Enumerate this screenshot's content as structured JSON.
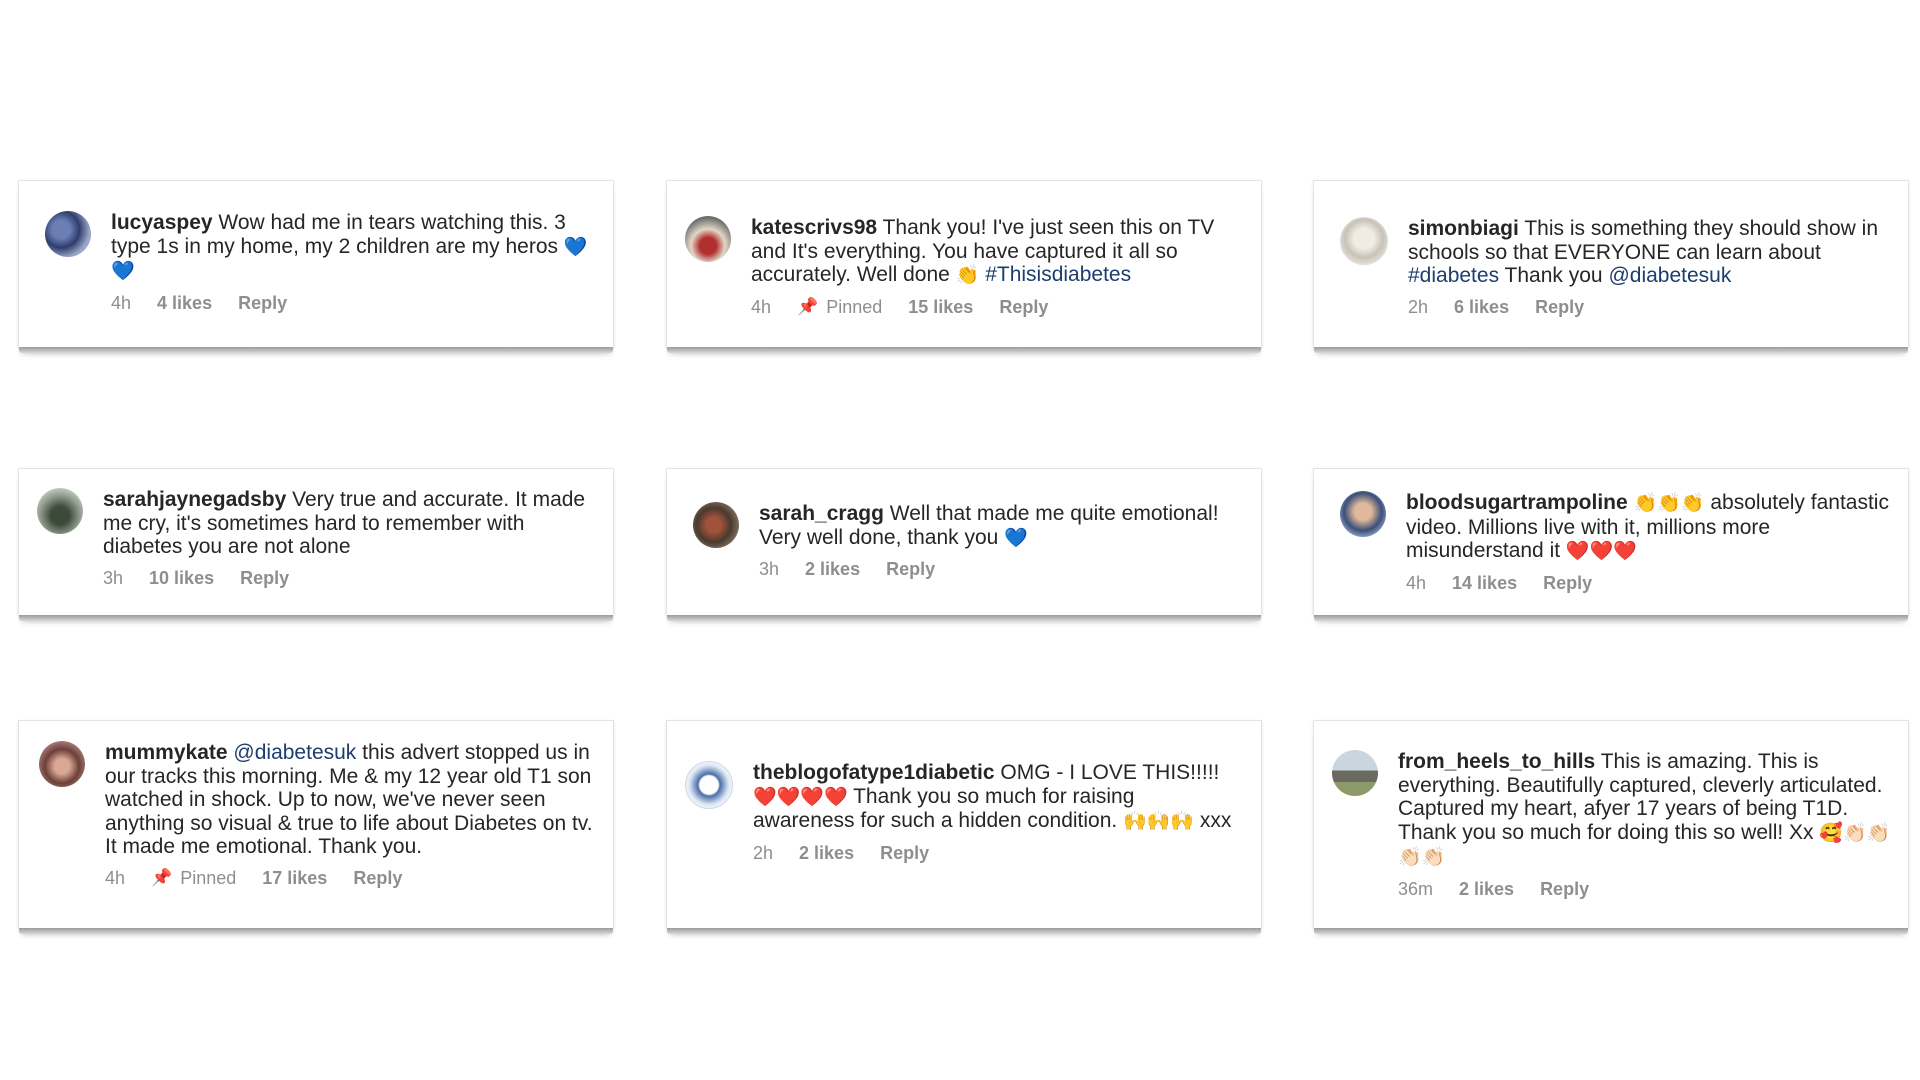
{
  "comments": [
    {
      "user": "lucyaspey",
      "text": "Wow had me in tears watching this. 3 type 1s in my home, my 2 children are my heros",
      "emoji": "💙💙",
      "time": "4h",
      "likes": "4 likes",
      "reply": "Reply"
    },
    {
      "user": "katescrivs98",
      "text": "Thank you! I've just seen this on TV and It's everything. You have captured it all so accurately. Well done",
      "emoji": "👏",
      "tag": "#Thisisdiabetes",
      "time": "4h",
      "pinned": "Pinned",
      "likes": "15 likes",
      "reply": "Reply"
    },
    {
      "user": "simonbiagi",
      "text": "This is something they should show in schools so that EVERYONE can learn about",
      "tag": "#diabetes",
      "text2": "Thank you",
      "mention": "@diabetesuk",
      "time": "2h",
      "likes": "6 likes",
      "reply": "Reply"
    },
    {
      "user": "sarahjaynegadsby",
      "text": "Very true and accurate. It made me cry, it's sometimes hard to remember with diabetes you are not alone",
      "time": "3h",
      "likes": "10 likes",
      "reply": "Reply"
    },
    {
      "user": "sarah_cragg",
      "text": "Well that made me quite emotional! Very well done, thank you",
      "emoji": "💙",
      "time": "3h",
      "likes": "2 likes",
      "reply": "Reply"
    },
    {
      "user": "bloodsugartrampoline",
      "emoji": "👏👏👏",
      "text": "absolutely fantastic video. Millions live with it, millions more misunderstand it",
      "emoji2": "❤️❤️❤️",
      "time": "4h",
      "likes": "14 likes",
      "reply": "Reply"
    },
    {
      "user": "mummykate",
      "mention": "@diabetesuk",
      "text": "this advert stopped us in our tracks this morning. Me & my 12 year old T1 son watched in shock. Up to now, we've never seen anything so visual & true to life about Diabetes on tv. It made me emotional. Thank you.",
      "time": "4h",
      "pinned": "Pinned",
      "likes": "17 likes",
      "reply": "Reply"
    },
    {
      "user": "theblogofatype1diabetic",
      "text": "OMG - I LOVE THIS!!!!!",
      "emoji": "❤️❤️❤️❤️",
      "text2": "Thank you so much for raising awareness for such a hidden condition.",
      "emoji2": "🙌🙌🙌",
      "text3": "xxx",
      "time": "2h",
      "likes": "2 likes",
      "reply": "Reply"
    },
    {
      "user": "from_heels_to_hills",
      "text": "This is amazing. This is everything. Beautifully captured, cleverly articulated. Captured my heart, afyer 17 years of being T1D. Thank you so much for doing this so well! Xx",
      "emoji": "🥰👏🏻👏🏻👏🏻👏🏻",
      "time": "36m",
      "likes": "2 likes",
      "reply": "Reply"
    }
  ],
  "colors": {
    "text": "#262626",
    "meta": "#8e8e8e",
    "link": "#1c3d6e"
  }
}
